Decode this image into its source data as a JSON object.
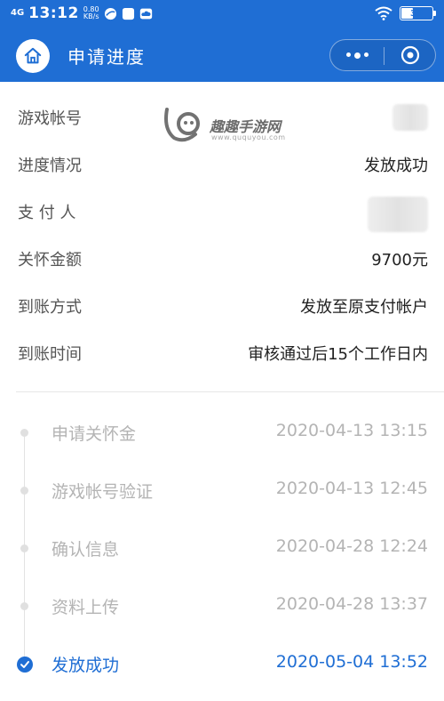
{
  "status_bar": {
    "network": "4G",
    "time": "13:12",
    "speed_value": "0.80",
    "speed_unit": "KB/s",
    "battery": "38",
    "battery_level": 0.38
  },
  "nav": {
    "title": "申请进度"
  },
  "watermark": {
    "text": "趣趣手游网",
    "subtext": "www.ququyou.com"
  },
  "info_rows": [
    {
      "label": "游戏帐号",
      "value": ""
    },
    {
      "label": "进度情况",
      "value": "发放成功"
    },
    {
      "label": "支 付 人",
      "value": ""
    },
    {
      "label": "关怀金额",
      "value": "9700元"
    },
    {
      "label": "到账方式",
      "value": "发放至原支付帐户"
    },
    {
      "label": "到账时间",
      "value": "审核通过后15个工作日内"
    }
  ],
  "timeline": [
    {
      "name": "申请关怀金",
      "time": "2020-04-13 13:15",
      "active": false
    },
    {
      "name": "游戏帐号验证",
      "time": "2020-04-13 12:45",
      "active": false
    },
    {
      "name": "确认信息",
      "time": "2020-04-28 12:24",
      "active": false
    },
    {
      "name": "资料上传",
      "time": "2020-04-28 13:37",
      "active": false
    },
    {
      "name": "发放成功",
      "time": "2020-05-04 13:52",
      "active": true
    }
  ],
  "colors": {
    "primary": "#1f6ed4",
    "inactive_text": "#b4b4b4",
    "label_text": "#555555"
  },
  "icons": {
    "home": "home-icon",
    "more": "more-dots-icon",
    "close": "capsule-close-icon",
    "check": "check-circle-icon",
    "wifi": "wifi-icon",
    "battery": "battery-icon"
  }
}
